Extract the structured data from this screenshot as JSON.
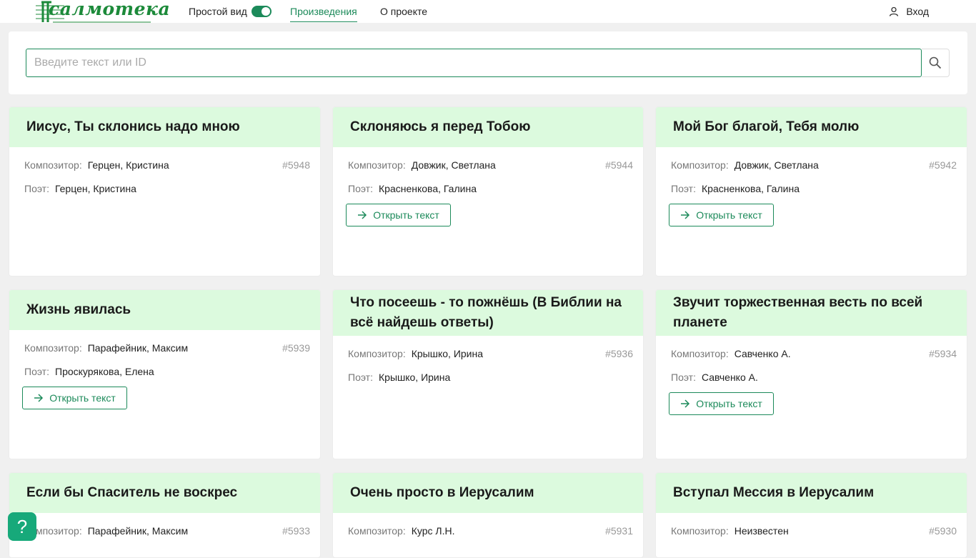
{
  "header": {
    "logo_text": "салмотека",
    "simple_view_label": "Простой вид",
    "nav": [
      {
        "label": "Произведения"
      },
      {
        "label": "О проекте"
      }
    ],
    "login_label": "Вход"
  },
  "search": {
    "placeholder": "Введите текст или ID"
  },
  "labels": {
    "composer": "Композитор",
    "poet": "Поэт",
    "open_text": "Открыть текст"
  },
  "cards": [
    {
      "title": "Иисус, Ты склонись надо мною",
      "composer": "Герцен, Кристина",
      "poet": "Герцен, Кристина",
      "id": "#5948",
      "has_text": false
    },
    {
      "title": "Склоняюсь я перед Тобою",
      "composer": "Довжик, Светлана",
      "poet": "Красненкова, Галина",
      "id": "#5944",
      "has_text": true
    },
    {
      "title": "Мой Бог благой, Тебя молю",
      "composer": "Довжик, Светлана",
      "poet": "Красненкова, Галина",
      "id": "#5942",
      "has_text": true
    },
    {
      "title": "Жизнь явилась",
      "composer": "Парафейник, Максим",
      "poet": "Проскурякова, Елена",
      "id": "#5939",
      "has_text": true
    },
    {
      "title": "Что посеешь - то пожнёшь (В Библии на всё найдешь ответы)",
      "composer": "Крышко, Ирина",
      "poet": "Крышко, Ирина",
      "id": "#5936",
      "has_text": false
    },
    {
      "title": "Звучит торжественная весть по всей планете",
      "composer": "Савченко А.",
      "poet": "Савченко А.",
      "id": "#5934",
      "has_text": true
    },
    {
      "title": "Если бы Спаситель не воскрес",
      "composer": "Парафейник, Максим",
      "id": "#5933"
    },
    {
      "title": "Очень просто в Иерусалим",
      "composer": "Курс Л.Н.",
      "id": "#5931"
    },
    {
      "title": "Вступал Мессия в Иерусалим",
      "composer": "Неизвестен",
      "id": "#5930"
    }
  ],
  "help_label": "?",
  "colors": {
    "accent": "#1c8a5a",
    "card_header": "#dcfade",
    "help_button": "#17a97a"
  }
}
